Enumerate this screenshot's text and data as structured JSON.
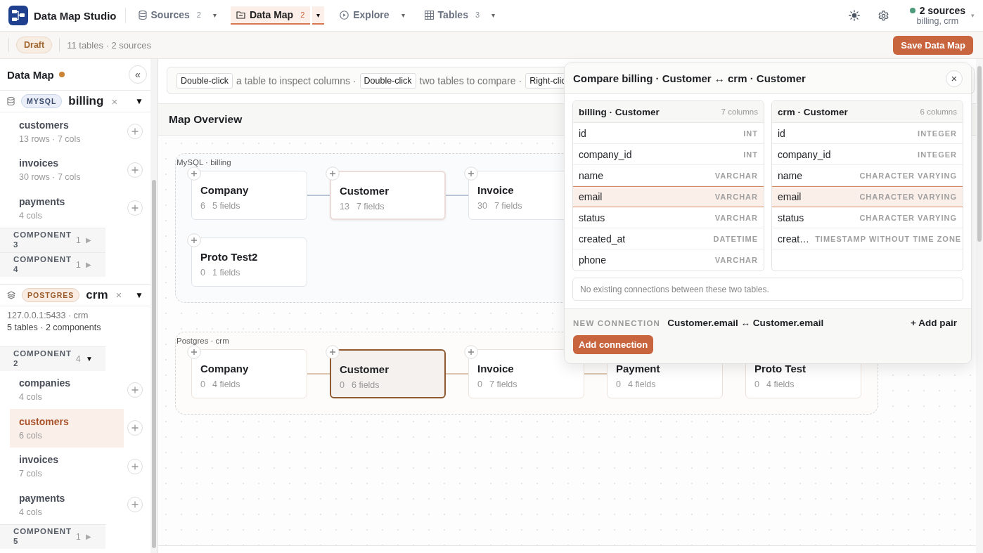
{
  "app": {
    "title": "Data Map Studio"
  },
  "nav_tabs": [
    {
      "label": "Sources",
      "count": "2",
      "caret": "▾",
      "selected": false
    },
    {
      "label": "Data Map",
      "count": "2",
      "caret": "▾",
      "selected": true
    },
    {
      "label": "Explore",
      "caret": "▾",
      "selected": false
    },
    {
      "label": "Tables",
      "count": "3",
      "caret": "▾",
      "selected": false
    }
  ],
  "connection_status": {
    "connected": true,
    "title": "2 sources",
    "detail": "billing, crm",
    "caret": "▾"
  },
  "toolbar": {
    "status_badge": "Draft",
    "summary": "11 tables · 2 sources",
    "save_button": "Save Data Map"
  },
  "sidebar": {
    "title": "Data Map",
    "unsaved": true,
    "collapse": "«",
    "sources": [
      {
        "kind": "mysql",
        "engine": "MYSQL",
        "name": "billing",
        "remove": "×",
        "toggle": "▼",
        "expanded": true,
        "items": [
          {
            "kind": "table",
            "name": "customers",
            "meta": "13 rows · 7 cols",
            "selected": false
          },
          {
            "kind": "table",
            "name": "invoices",
            "meta": "30 rows · 7 cols",
            "selected": false
          },
          {
            "kind": "table",
            "name": "payments",
            "meta": "4 cols",
            "selected": false
          },
          {
            "kind": "component",
            "label": "COMPONENT 3",
            "count": "1",
            "toggle": "▶",
            "expanded": false
          },
          {
            "kind": "component",
            "label": "COMPONENT 4",
            "count": "1",
            "toggle": "▶",
            "expanded": false
          }
        ]
      },
      {
        "kind": "postgres",
        "engine": "POSTGRES",
        "name": "crm",
        "remove": "×",
        "toggle": "▼",
        "expanded": true,
        "info": [
          "127.0.0.1:5433 · crm",
          "5 tables · 2 components"
        ],
        "items": [
          {
            "kind": "component",
            "label": "COMPONENT 2",
            "count": "4",
            "toggle": "▼",
            "expanded": true,
            "children": [
              {
                "kind": "table",
                "name": "companies",
                "meta": "4 cols",
                "selected": false
              },
              {
                "kind": "table",
                "name": "customers",
                "meta": "6 cols",
                "selected": true
              },
              {
                "kind": "table",
                "name": "invoices",
                "meta": "7 cols",
                "selected": false
              },
              {
                "kind": "table",
                "name": "payments",
                "meta": "4 cols",
                "selected": false
              }
            ]
          },
          {
            "kind": "component",
            "label": "COMPONENT 5",
            "count": "1",
            "toggle": "▶",
            "expanded": false
          }
        ]
      }
    ]
  },
  "hints": [
    {
      "kind": "key",
      "text": "Double-click"
    },
    {
      "kind": "text",
      "text": "a table to inspect columns ·"
    },
    {
      "kind": "key",
      "text": "Double-click"
    },
    {
      "kind": "text",
      "text": "two tables to compare ·"
    },
    {
      "kind": "key",
      "text": "Right-clic"
    }
  ],
  "canvas": {
    "title": "Map Overview",
    "groups": [
      {
        "kind": "mysql",
        "label": "MySQL · billing",
        "rows": [
          {
            "nodes": [
              {
                "name": "Company",
                "rows": "6",
                "fields": "5 fields",
                "selected": false,
                "highlighted": false,
                "linked_to_next": true,
                "add_visible": true
              },
              {
                "name": "Customer",
                "rows": "13",
                "fields": "7 fields",
                "selected": false,
                "highlighted": true,
                "linked_to_next": true,
                "add_visible": true
              },
              {
                "name": "Invoice",
                "rows": "30",
                "fields": "7 fields",
                "selected": false,
                "highlighted": false,
                "add_visible": true
              }
            ]
          },
          {
            "nodes": [
              {
                "name": "Proto Test2",
                "rows": "0",
                "fields": "1 fields",
                "selected": false,
                "highlighted": false,
                "add_visible": true
              }
            ]
          }
        ]
      },
      {
        "kind": "postgres",
        "label": "Postgres · crm",
        "rows": [
          {
            "nodes": [
              {
                "name": "Company",
                "rows": "0",
                "fields": "4 fields",
                "selected": false,
                "highlighted": false,
                "linked_to_next": true,
                "add_visible": true
              },
              {
                "name": "Customer",
                "rows": "0",
                "fields": "6 fields",
                "selected": true,
                "highlighted": false,
                "linked_to_next": true,
                "add_visible": true
              },
              {
                "name": "Invoice",
                "rows": "0",
                "fields": "7 fields",
                "selected": false,
                "highlighted": false,
                "linked_to_next": true,
                "add_visible": true
              },
              {
                "name": "Payment",
                "rows": "0",
                "fields": "4 fields",
                "selected": false,
                "highlighted": false
              },
              {
                "name": "Proto Test",
                "rows": "0",
                "fields": "4 fields",
                "selected": false,
                "highlighted": false
              }
            ]
          }
        ]
      }
    ]
  },
  "compare": {
    "title": "Compare billing · Customer ↔ crm · Customer",
    "close": "×",
    "tables": [
      {
        "name": "billing · Customer",
        "count": "7 columns",
        "columns": [
          {
            "name": "id",
            "type": "INT",
            "selected": false
          },
          {
            "name": "company_id",
            "type": "INT",
            "selected": false
          },
          {
            "name": "name",
            "type": "VARCHAR",
            "selected": false
          },
          {
            "name": "email",
            "type": "VARCHAR",
            "selected": true
          },
          {
            "name": "status",
            "type": "VARCHAR",
            "selected": false
          },
          {
            "name": "created_at",
            "type": "DATETIME",
            "selected": false
          },
          {
            "name": "phone",
            "type": "VARCHAR",
            "selected": false
          }
        ]
      },
      {
        "name": "crm · Customer",
        "count": "6 columns",
        "columns": [
          {
            "name": "id",
            "type": "INTEGER",
            "selected": false
          },
          {
            "name": "company_id",
            "type": "INTEGER",
            "selected": false
          },
          {
            "name": "name",
            "type": "CHARACTER VARYING",
            "selected": false
          },
          {
            "name": "email",
            "type": "CHARACTER VARYING",
            "selected": true
          },
          {
            "name": "status",
            "type": "CHARACTER VARYING",
            "selected": false
          },
          {
            "name": "creat…",
            "type": "TIMESTAMP WITHOUT TIME ZONE",
            "selected": false
          }
        ]
      }
    ],
    "note": "No existing connections between these two tables.",
    "new_connection_label": "NEW CONNECTION",
    "new_connection_pair": "Customer.email ↔ Customer.email",
    "add_pair": "+ Add pair",
    "add_button": "Add connection"
  }
}
